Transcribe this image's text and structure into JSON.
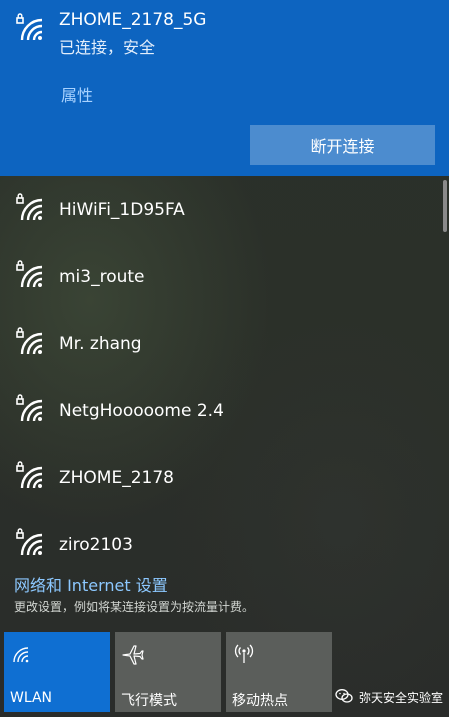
{
  "connected_network": {
    "name": "ZHOME_2178_5G",
    "status": "已连接，安全",
    "properties_link": "属性",
    "disconnect_button": "断开连接"
  },
  "networks": [
    {
      "name": "HiWiFi_1D95FA",
      "icon": "secured-wifi-icon"
    },
    {
      "name": "mi3_route",
      "icon": "secured-wifi-icon"
    },
    {
      "name": "Mr. zhang",
      "icon": "secured-wifi-icon"
    },
    {
      "name": "NetgHooooome 2.4",
      "icon": "secured-wifi-icon"
    },
    {
      "name": "ZHOME_2178",
      "icon": "secured-wifi-icon"
    },
    {
      "name": "ziro2103",
      "icon": "secured-wifi-icon"
    }
  ],
  "settings": {
    "link": "网络和 Internet 设置",
    "description": "更改设置，例如将某连接设置为按流量计费。"
  },
  "quick_actions": [
    {
      "label": "WLAN",
      "icon": "wifi-icon",
      "active": true
    },
    {
      "label": "飞行模式",
      "icon": "airplane-icon",
      "active": false
    },
    {
      "label": "移动热点",
      "icon": "hotspot-icon",
      "active": false
    }
  ],
  "watermark": {
    "text": "弥天安全实验室",
    "icon": "wechat-icon"
  },
  "colors": {
    "accent": "#0d64c0",
    "accent_tile": "#0f6fd2",
    "disconnect_button_bg": "#4c8ccf",
    "link": "#8cc8ff",
    "tile_inactive": "#5b5e5b"
  }
}
